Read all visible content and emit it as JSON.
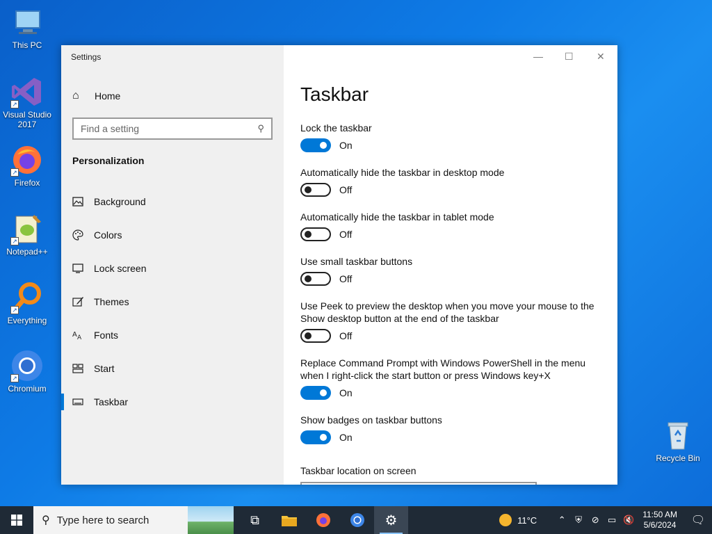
{
  "desktop": {
    "icons": [
      {
        "label": "This PC"
      },
      {
        "label": "Visual Studio 2017"
      },
      {
        "label": "Firefox"
      },
      {
        "label": "Notepad++"
      },
      {
        "label": "Everything"
      },
      {
        "label": "Chromium"
      }
    ],
    "recycle_bin": "Recycle Bin"
  },
  "window": {
    "title": "Settings",
    "controls": {
      "minimize": "—",
      "maximize": "☐",
      "close": "✕"
    },
    "sidebar": {
      "home": "Home",
      "search_placeholder": "Find a setting",
      "section": "Personalization",
      "items": [
        {
          "label": "Background",
          "icon": "image-icon"
        },
        {
          "label": "Colors",
          "icon": "palette-icon"
        },
        {
          "label": "Lock screen",
          "icon": "monitor-icon"
        },
        {
          "label": "Themes",
          "icon": "brush-icon"
        },
        {
          "label": "Fonts",
          "icon": "font-icon"
        },
        {
          "label": "Start",
          "icon": "grid-icon"
        },
        {
          "label": "Taskbar",
          "icon": "taskbar-icon",
          "active": true
        }
      ]
    },
    "content": {
      "title": "Taskbar",
      "options": [
        {
          "label": "Lock the taskbar",
          "state": "On"
        },
        {
          "label": "Automatically hide the taskbar in desktop mode",
          "state": "Off"
        },
        {
          "label": "Automatically hide the taskbar in tablet mode",
          "state": "Off"
        },
        {
          "label": "Use small taskbar buttons",
          "state": "Off"
        },
        {
          "label": "Use Peek to preview the desktop when you move your mouse to the Show desktop button at the end of the taskbar",
          "state": "Off"
        },
        {
          "label": "Replace Command Prompt with Windows PowerShell in the menu when I right-click the start button or press Windows key+X",
          "state": "On"
        },
        {
          "label": "Show badges on taskbar buttons",
          "state": "On"
        }
      ],
      "location_label": "Taskbar location on screen"
    }
  },
  "taskbar": {
    "search_placeholder": "Type here to search",
    "weather": "11°C",
    "time": "11:50 AM",
    "date": "5/6/2024"
  },
  "colors": {
    "accent": "#0078d7",
    "taskbar": "#1f2a36"
  }
}
